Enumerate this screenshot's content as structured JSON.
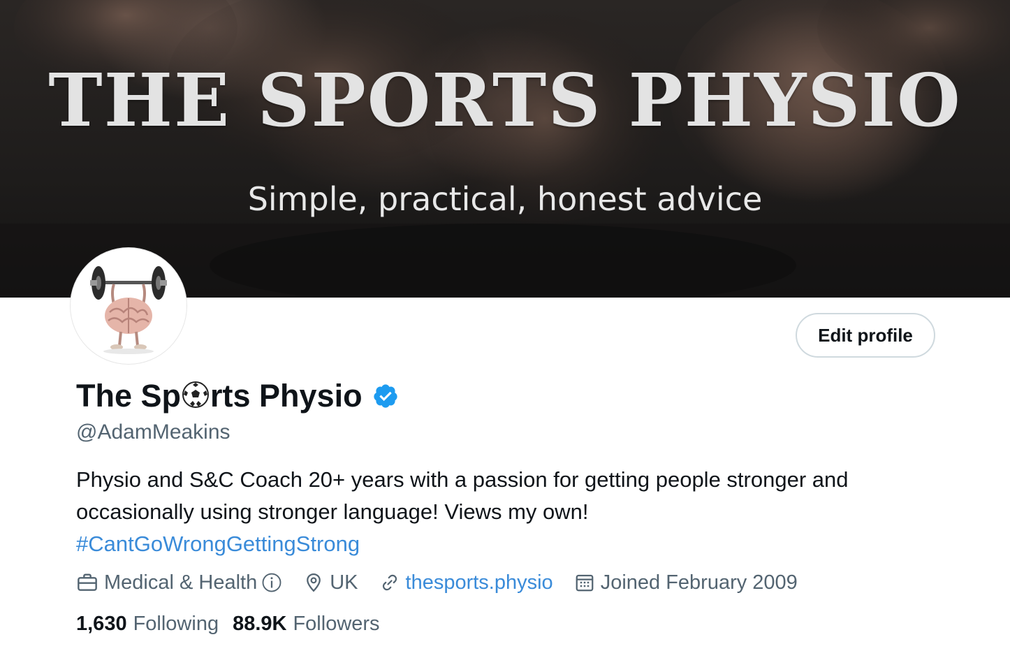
{
  "banner": {
    "title": "THE SPORTS PHYSIO",
    "subtitle": "Simple, practical, honest advice"
  },
  "profile": {
    "name_part1": "The Sp",
    "name_emoji": "soccer-ball-icon",
    "name_part2": "rts Physio",
    "verified_icon": "verified-badge-icon",
    "handle": "@AdamMeakins",
    "avatar_icon": "brain-lifting-barbell-icon"
  },
  "actions": {
    "edit_profile_label": "Edit profile"
  },
  "bio": {
    "line1": "Physio and S&C Coach 20+ years with a passion for getting people stronger and",
    "line2": "occasionally using stronger language! Views my own!",
    "hashtag": "#CantGoWrongGettingStrong"
  },
  "meta": {
    "category": "Medical & Health",
    "category_icon": "briefcase-icon",
    "info_icon": "info-icon",
    "location": "UK",
    "location_icon": "location-pin-icon",
    "website": "thesports.physio",
    "website_icon": "link-icon",
    "joined": "Joined February 2009",
    "joined_icon": "calendar-icon"
  },
  "stats": {
    "following_count": "1,630",
    "following_label": "Following",
    "followers_count": "88.9K",
    "followers_label": "Followers"
  },
  "colors": {
    "link": "#3a8bd9",
    "verified": "#1d9bf0",
    "secondary_text": "#536471",
    "primary_text": "#0f1419"
  }
}
